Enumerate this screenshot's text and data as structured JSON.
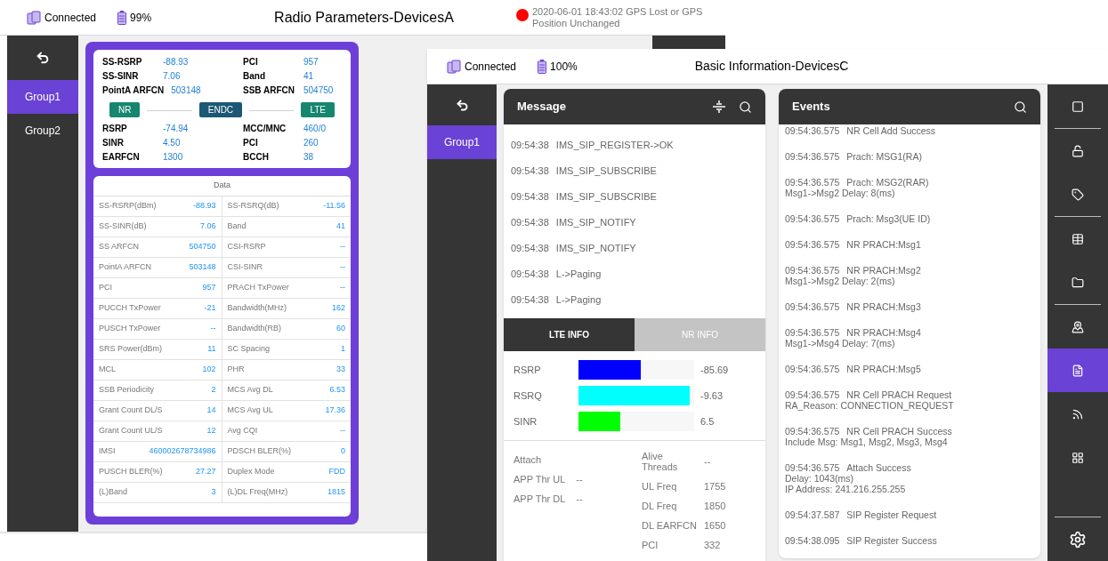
{
  "window_a": {
    "status": {
      "connection": "Connected",
      "battery": "99%"
    },
    "title": "Radio Parameters-DevicesA",
    "gps": {
      "date": "2020-06-01",
      "time": "18:43:02",
      "text": "GPS Lost or GPS Position Unchanged"
    },
    "sidebar": [
      {
        "label": "Group1",
        "selected": true
      },
      {
        "label": "Group2",
        "selected": false
      }
    ],
    "summary_top": [
      {
        "label": "SS-RSRP",
        "value": "-88.93"
      },
      {
        "label": "PCI",
        "value": "957"
      },
      {
        "label": "SS-SINR",
        "value": "7.06"
      },
      {
        "label": "Band",
        "value": "41"
      },
      {
        "label": "PointA ARFCN",
        "value": "503148"
      },
      {
        "label": "SSB ARFCN",
        "value": "504750"
      }
    ],
    "badges": [
      {
        "label": "NR",
        "color": "#17866f"
      },
      {
        "label": "ENDC",
        "color": "#1b5876"
      },
      {
        "label": "LTE",
        "color": "#17866f"
      }
    ],
    "summary_bottom": [
      {
        "label": "RSRP",
        "value": "-74.94"
      },
      {
        "label": "MCC/MNC",
        "value": "460/0"
      },
      {
        "label": "SINR",
        "value": "4.50"
      },
      {
        "label": "PCI",
        "value": "260"
      },
      {
        "label": "EARFCN",
        "value": "1300"
      },
      {
        "label": "BCCH",
        "value": "38"
      }
    ],
    "data_table": {
      "title": "Data",
      "rows": [
        [
          "SS-RSRP(dBm)",
          "-88.93",
          "SS-RSRQ(dB)",
          "-11.56"
        ],
        [
          "SS-SINR(dB)",
          "7.06",
          "Band",
          "41"
        ],
        [
          "SS ARFCN",
          "504750",
          "CSI-RSRP",
          "--"
        ],
        [
          "PointA ARFCN",
          "503148",
          "CSI-SINR",
          "--"
        ],
        [
          "PCI",
          "957",
          "PRACH TxPower",
          "--"
        ],
        [
          "PUCCH TxPower",
          "-21",
          "Bandwidth(MHz)",
          "162"
        ],
        [
          "PUSCH TxPower",
          "--",
          "Bandwidth(RB)",
          "60"
        ],
        [
          "SRS Power(dBm)",
          "11",
          "SC Spacing",
          "1"
        ],
        [
          "MCL",
          "102",
          "PHR",
          "33"
        ],
        [
          "SSB Periodicity",
          "2",
          "MCS Avg DL",
          "6.53"
        ],
        [
          "Grant Count DL/S",
          "14",
          "MCS Avg UL",
          "17.36"
        ],
        [
          "Grant Count UL/S",
          "12",
          "Avg CQI",
          "--"
        ],
        [
          "IMSI",
          "460002678734986",
          "PDSCH BLER(%)",
          "0"
        ],
        [
          "PUSCH BLER(%)",
          "27.27",
          "Duplex Mode",
          "FDD"
        ],
        [
          "(L)Band",
          "3",
          "(L)DL Freq(MHz)",
          "1815"
        ]
      ]
    }
  },
  "window_b": {
    "status": {
      "connection": "Connected",
      "battery": "100%"
    },
    "title": "Basic Information-DevicesC",
    "sidebar": [
      {
        "label": "Group1",
        "selected": true
      }
    ],
    "message_panel": {
      "title": "Message",
      "items": [
        {
          "time": "09:54:38",
          "text": "IMS_SIP_REGISTER->OK"
        },
        {
          "time": "09:54:38",
          "text": "IMS_SIP_SUBSCRIBE"
        },
        {
          "time": "09:54:38",
          "text": "IMS_SIP_SUBSCRIBE"
        },
        {
          "time": "09:54:38",
          "text": "IMS_SIP_NOTIFY"
        },
        {
          "time": "09:54:38",
          "text": "IMS_SIP_NOTIFY"
        },
        {
          "time": "09:54:38",
          "text": "L->Paging"
        },
        {
          "time": "09:54:38",
          "text": "L->Paging"
        }
      ]
    },
    "info_tabs": [
      {
        "label": "LTE INFO",
        "selected": true
      },
      {
        "label": "NR INFO",
        "selected": false
      }
    ],
    "bars": [
      {
        "label": "RSRP",
        "level": 0.54,
        "color": "#0000ff",
        "reading": "-85.69"
      },
      {
        "label": "RSRQ",
        "level": 0.96,
        "color": "#00ffff",
        "reading": "-9.63"
      },
      {
        "label": "SINR",
        "level": 0.36,
        "color": "#00ff00",
        "reading": "6.5"
      }
    ],
    "info_left": [
      {
        "label": "Attach"
      },
      {
        "label": "APP Thr UL",
        "value": "--"
      },
      {
        "label": "APP Thr DL",
        "value": "--"
      }
    ],
    "info_right": [
      {
        "label": "Alive Threads",
        "value": "--"
      },
      {
        "label": "UL Freq",
        "value": "1755"
      },
      {
        "label": "DL Freq",
        "value": "1850"
      },
      {
        "label": "DL EARFCN",
        "value": "1650"
      },
      {
        "label": "PCI",
        "value": "332"
      }
    ],
    "events_panel": {
      "title": "Events",
      "items": [
        {
          "time": "09:54:36.575",
          "title": "NR Cell Add Success"
        },
        {
          "time": "09:54:36.575",
          "title": "Prach: MSG1(RA)"
        },
        {
          "time": "09:54:36.575",
          "title": "Prach: MSG2(RAR)",
          "details": [
            "Msg1->Msg2 Delay: 8(ms)"
          ]
        },
        {
          "time": "09:54:36.575",
          "title": "Prach: Msg3(UE ID)"
        },
        {
          "time": "09:54:36.575",
          "title": "NR PRACH:Msg1"
        },
        {
          "time": "09:54:36.575",
          "title": "NR PRACH:Msg2",
          "details": [
            "Msg1->Msg2 Delay: 2(ms)"
          ]
        },
        {
          "time": "09:54:36.575",
          "title": "NR PRACH:Msg3"
        },
        {
          "time": "09:54:36.575",
          "title": "NR PRACH:Msg4",
          "details": [
            "Msg1->Msg4 Delay: 7(ms)"
          ]
        },
        {
          "time": "09:54:36.575",
          "title": "NR PRACH:Msg5"
        },
        {
          "time": "09:54:36.575",
          "title": "NR Cell PRACH Request",
          "details": [
            "RA_Reason: CONNECTION_REQUEST"
          ]
        },
        {
          "time": "09:54:36.575",
          "title": "NR Cell PRACH Success",
          "details": [
            "Include Msg: Msg1, Msg2, Msg3, Msg4"
          ]
        },
        {
          "time": "09:54:36.575",
          "title": "Attach Success",
          "details": [
            "Delay: 1043(ms)",
            "IP Address: 241.216.255.255"
          ]
        },
        {
          "time": "09:54:37.587",
          "title": "SIP Register Request"
        },
        {
          "time": "09:54:38.095",
          "title": "SIP Register Success"
        }
      ]
    },
    "toolbar": [
      {
        "selected": false
      },
      {
        "selected": false
      },
      {
        "selected": false
      },
      {
        "selected": false
      },
      {
        "selected": false
      },
      {
        "selected": false
      },
      {
        "selected": true
      },
      {
        "selected": false
      },
      {
        "selected": false
      },
      {
        "selected": false
      }
    ]
  }
}
